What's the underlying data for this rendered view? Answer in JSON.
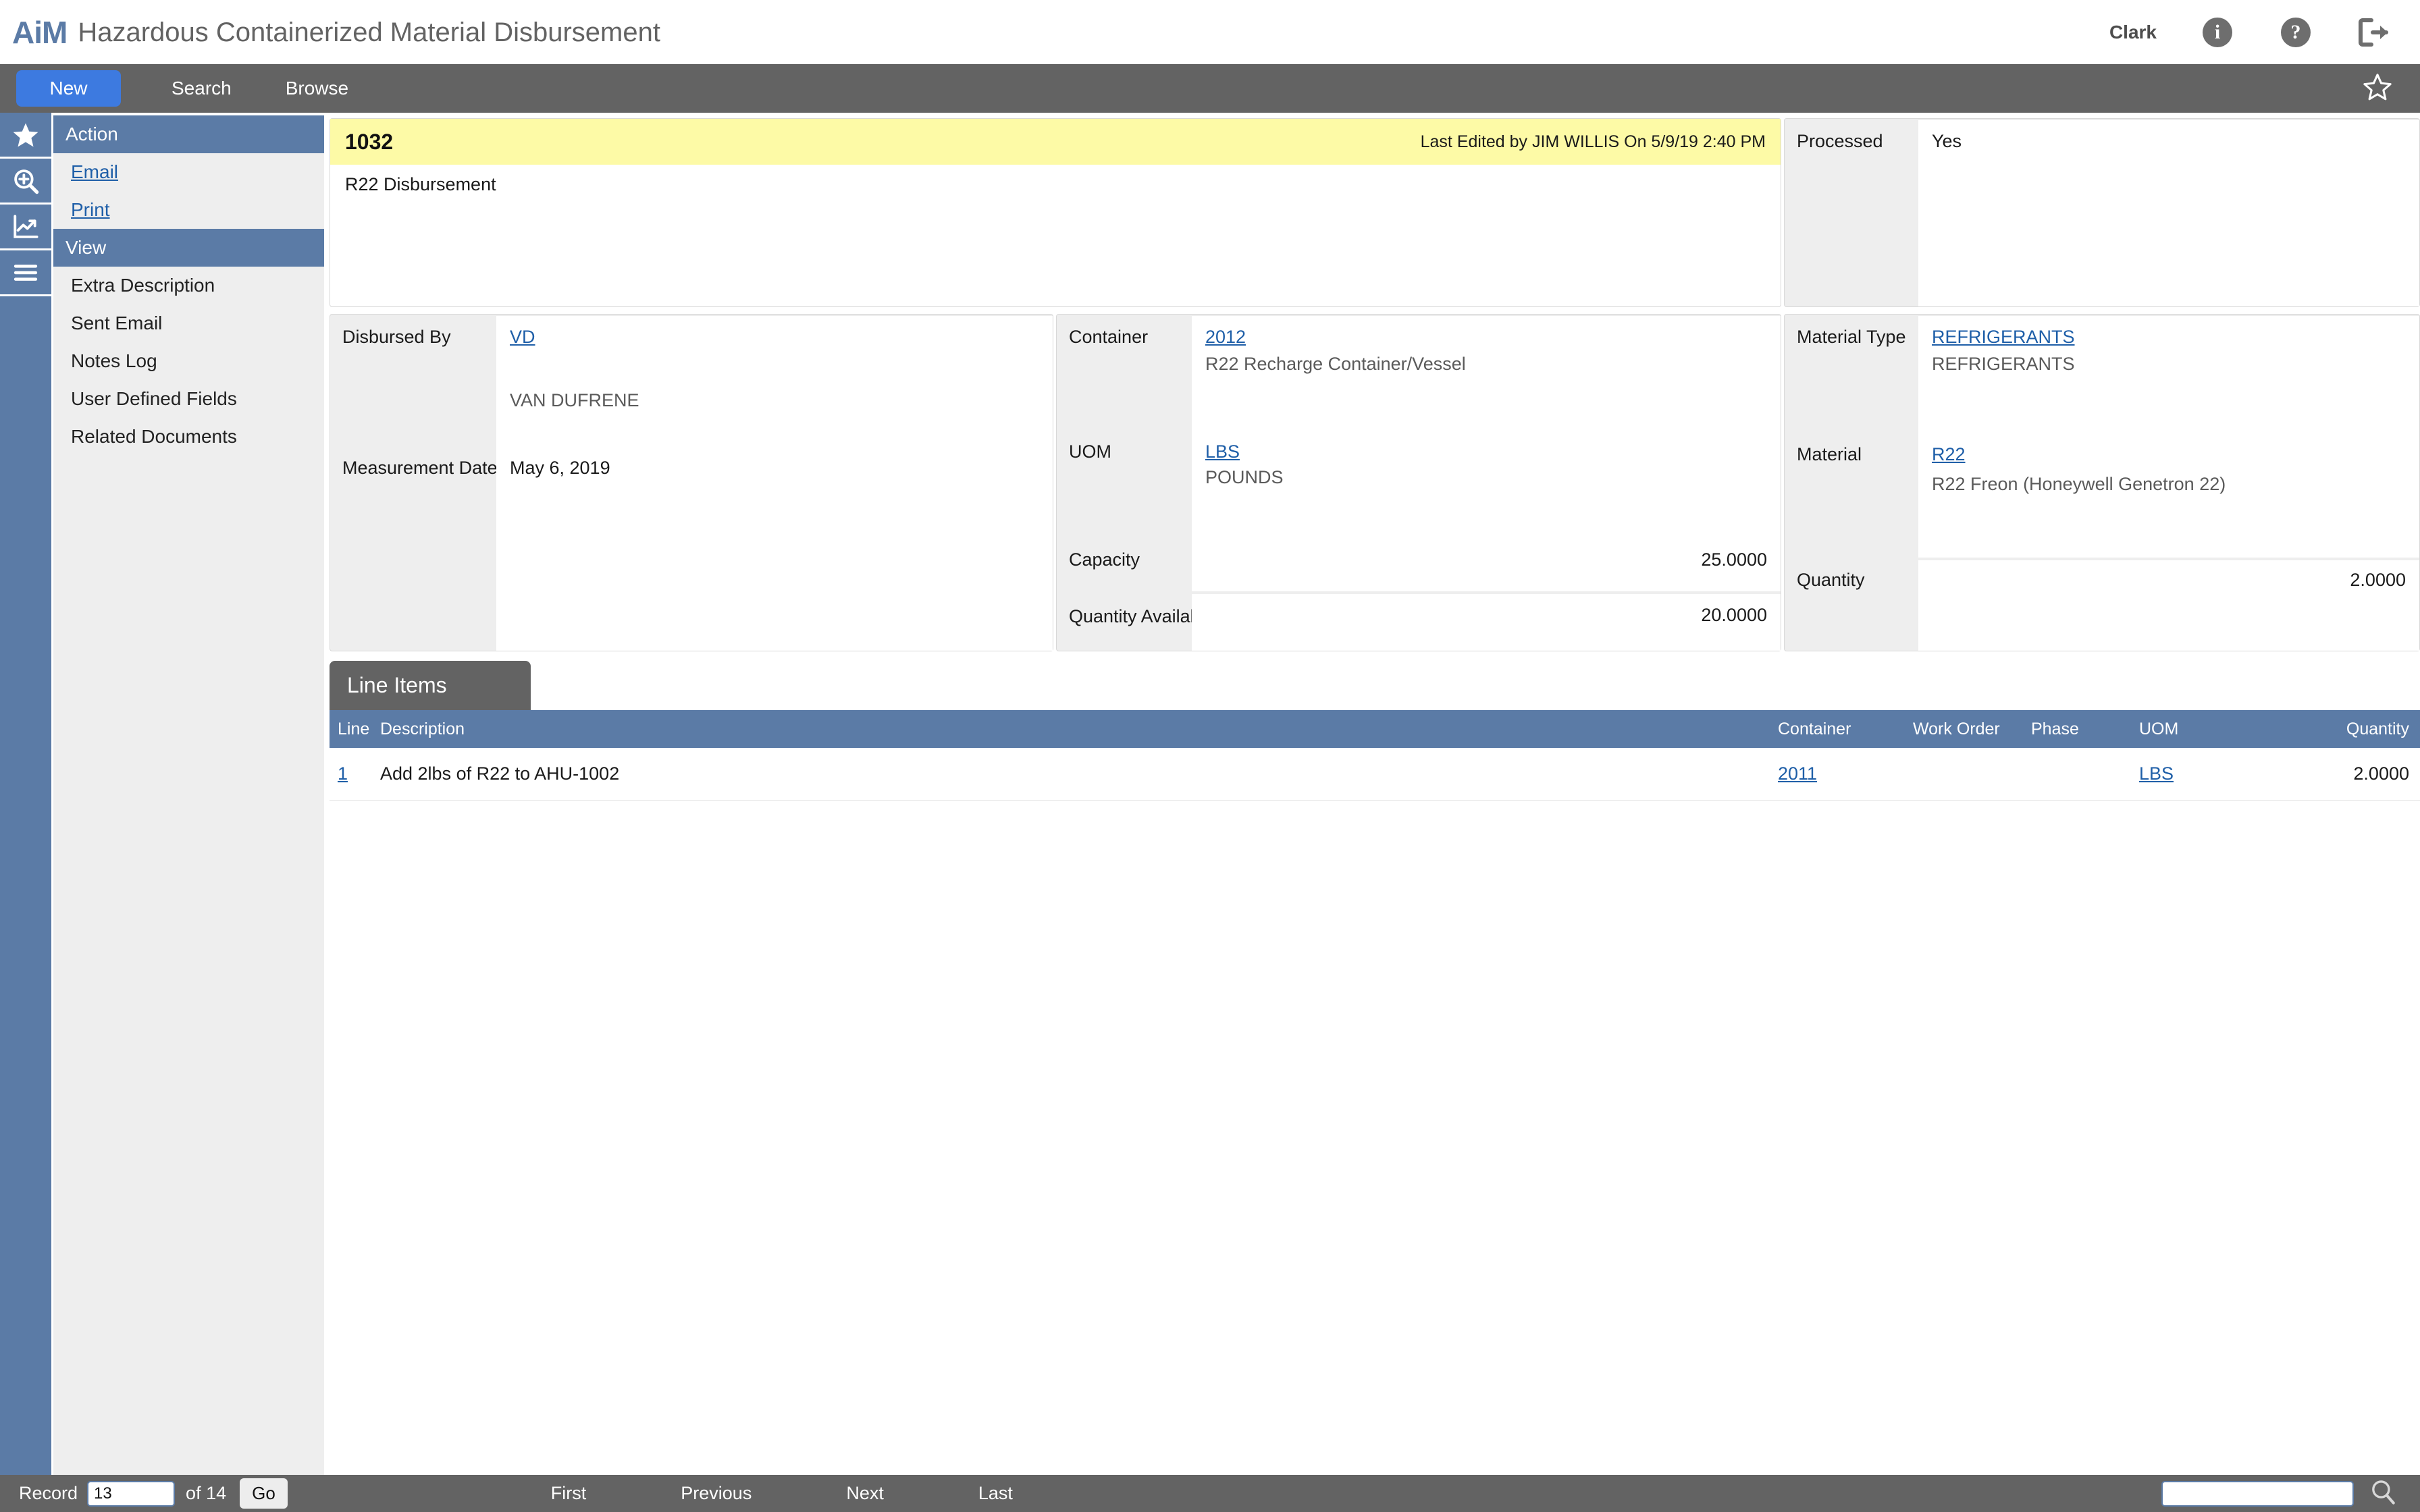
{
  "titlebar": {
    "logo": "AiM",
    "title": "Hazardous Containerized Material Disbursement",
    "user": "Clark",
    "icons": [
      "info-icon",
      "help-icon",
      "logout-icon"
    ]
  },
  "navbar": {
    "new_label": "New",
    "search_label": "Search",
    "browse_label": "Browse",
    "favorite_icon": "star-outline-icon"
  },
  "rail": {
    "items": [
      "star-icon",
      "zoom-search-icon",
      "chart-icon",
      "menu-icon"
    ]
  },
  "sidebar": {
    "action_header": "Action",
    "action_links": [
      "Email",
      "Print"
    ],
    "view_header": "View",
    "view_items": [
      "Extra Description",
      "Sent Email",
      "Notes Log",
      "User Defined Fields",
      "Related Documents"
    ]
  },
  "record": {
    "id": "1032",
    "last_edited": "Last Edited by JIM WILLIS On 5/9/19 2:40 PM",
    "description": "R22 Disbursement"
  },
  "processed": {
    "label": "Processed",
    "value": "Yes"
  },
  "disbursed": {
    "disbursed_by_label": "Disbursed By",
    "disbursed_by_code": "VD",
    "disbursed_by_name": "VAN DUFRENE",
    "measurement_date_label": "Measurement Date",
    "measurement_date": "May 6, 2019"
  },
  "container": {
    "container_label": "Container",
    "container_code": "2012",
    "container_name": "R22 Recharge Container/Vessel",
    "uom_label": "UOM",
    "uom_code": "LBS",
    "uom_name": "POUNDS",
    "capacity_label": "Capacity",
    "capacity_value": "25.0000",
    "qty_available_label": "Quantity Available",
    "qty_available_value": "20.0000"
  },
  "material": {
    "material_type_label": "Material Type",
    "material_type_code": "REFRIGERANTS",
    "material_type_name": "REFRIGERANTS",
    "material_label": "Material",
    "material_code": "R22",
    "material_name": "R22 Freon (Honeywell Genetron 22)",
    "quantity_label": "Quantity",
    "quantity_value": "2.0000"
  },
  "line_items": {
    "tab_label": "Line Items",
    "columns": [
      "Line",
      "Description",
      "Container",
      "Work Order",
      "Phase",
      "UOM",
      "Quantity"
    ],
    "rows": [
      {
        "line": "1",
        "description": "Add 2lbs of R22 to AHU-1002",
        "container": "2011",
        "work_order": "",
        "phase": "",
        "uom": "LBS",
        "quantity": "2.0000"
      }
    ]
  },
  "bottombar": {
    "record_label": "Record",
    "record_value": "13",
    "of_label": "of 14",
    "go_label": "Go",
    "first_label": "First",
    "previous_label": "Previous",
    "next_label": "Next",
    "last_label": "Last",
    "search_value": "",
    "search_icon": "search-icon"
  },
  "colors": {
    "accent_blue": "#5b7ba6",
    "nav_blue": "#3d7ae0",
    "dark_gray": "#636363",
    "highlight_yellow": "#fdfaa6",
    "link_blue": "#1f5fa8"
  }
}
